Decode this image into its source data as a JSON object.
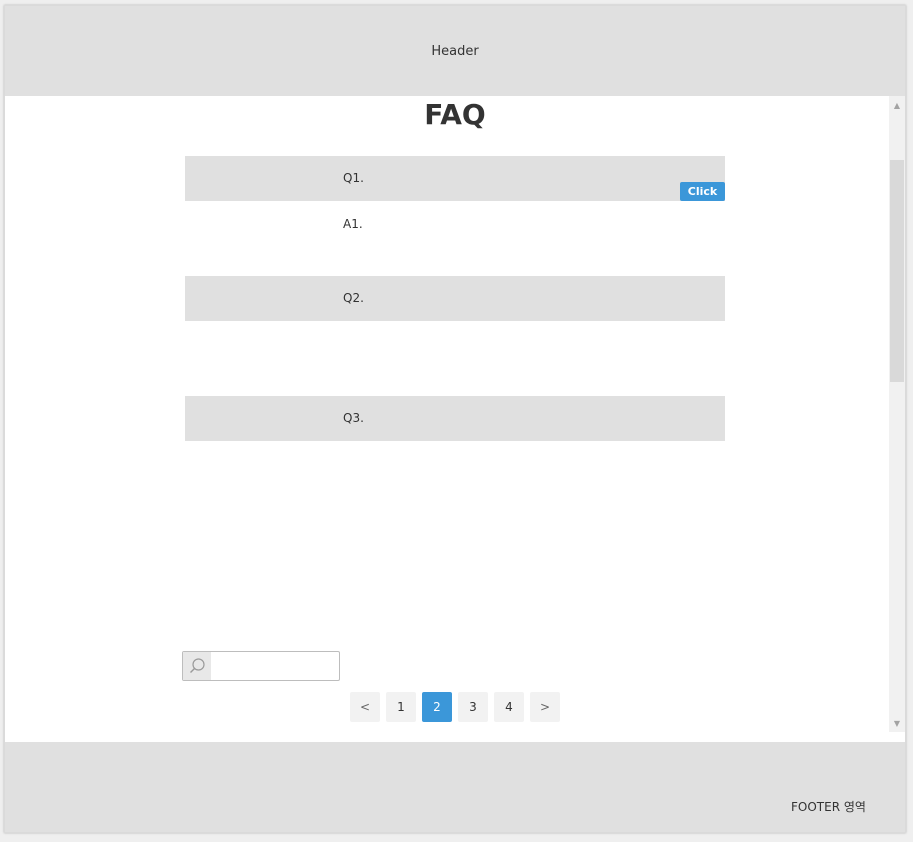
{
  "header": {
    "title": "Header"
  },
  "main": {
    "title": "FAQ",
    "faq": [
      {
        "question": "Q1.",
        "answer": "A1."
      },
      {
        "question": "Q2.",
        "answer": ""
      },
      {
        "question": "Q3.",
        "answer": ""
      }
    ],
    "click_label": "Click",
    "search": {
      "value": "",
      "placeholder": ""
    },
    "pagination": {
      "prev": "<",
      "pages": [
        "1",
        "2",
        "3",
        "4"
      ],
      "current": "2",
      "next": ">"
    }
  },
  "footer": {
    "text": "FOOTER 영역"
  },
  "colors": {
    "accent": "#3b97d9",
    "header_bg": "#e0e0e0",
    "question_bg": "#e0e0e0"
  }
}
